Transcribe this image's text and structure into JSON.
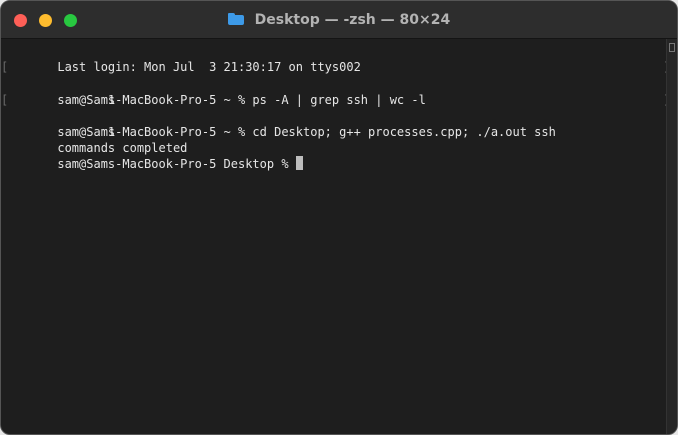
{
  "window": {
    "title": "Desktop — -zsh — 80×24"
  },
  "colors": {
    "close": "#fe5f57",
    "minimize": "#febc2e",
    "zoom": "#28c840",
    "folder": "#3d9ae8",
    "background": "#1e1e1e",
    "text": "#e6e6e6"
  },
  "icons": {
    "folder": "folder-icon",
    "close": "close-button",
    "minimize": "minimize-button",
    "zoom": "zoom-button"
  },
  "terminal": {
    "lines": [
      {
        "text": "Last login: Mon Jul  3 21:30:17 on ttys002",
        "marked": false
      },
      {
        "text": "sam@Sams-MacBook-Pro-5 ~ % ps -A | grep ssh | wc -l",
        "marked": true
      },
      {
        "text": "       1",
        "marked": false
      },
      {
        "text": "sam@Sams-MacBook-Pro-5 ~ % cd Desktop; g++ processes.cpp; ./a.out ssh",
        "marked": true
      },
      {
        "text": "       1",
        "marked": false
      },
      {
        "text": "commands completed",
        "marked": false
      }
    ],
    "prompt": "sam@Sams-MacBook-Pro-5 Desktop % "
  }
}
